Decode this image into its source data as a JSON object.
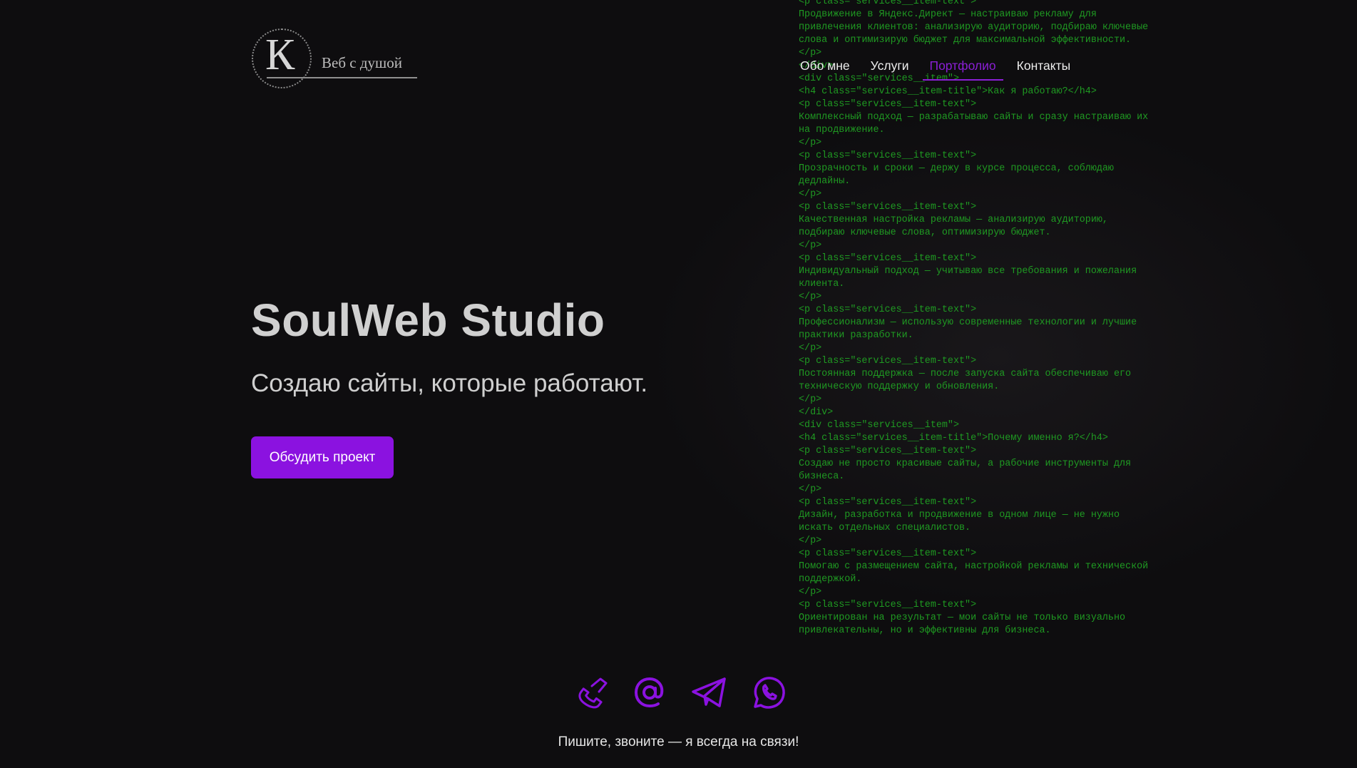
{
  "logo": {
    "letter": "К",
    "tagline": "Веб с душой"
  },
  "nav": {
    "items": [
      {
        "label": "Обо мне",
        "active": false
      },
      {
        "label": "Услуги",
        "active": false
      },
      {
        "label": "Портфолио",
        "active": true
      },
      {
        "label": "Контакты",
        "active": false
      }
    ]
  },
  "hero": {
    "title": "SoulWeb Studio",
    "subtitle": "Создаю сайты, которые работают.",
    "cta_label": "Обсудить проект"
  },
  "code_lines": [
    "<p class=\"services__item-text\">",
    "Продвижение в Яндекс.Директ — настраиваю рекламу для",
    "привлечения клиентов: анализирую аудиторию, подбираю ключевые",
    "слова и оптимизирую бюджет для максимальной эффективности.",
    "</p>",
    "</div>",
    "<div class=\"services__item\">",
    "<h4 class=\"services__item-title\">Как я работаю?</h4>",
    "<p class=\"services__item-text\">",
    "Комплексный подход — разрабатываю сайты и сразу настраиваю их",
    "на продвижение.",
    "</p>",
    "<p class=\"services__item-text\">",
    "Прозрачность и сроки — держу в курсе процесса, соблюдаю",
    "дедлайны.",
    "</p>",
    "<p class=\"services__item-text\">",
    "Качественная настройка рекламы — анализирую аудиторию,",
    "подбираю ключевые слова, оптимизирую бюджет.",
    "</p>",
    "<p class=\"services__item-text\">",
    "Индивидуальный подход — учитываю все требования и пожелания",
    "клиента.",
    "</p>",
    "<p class=\"services__item-text\">",
    "Профессионализм — использую современные технологии и лучшие",
    "практики разработки.",
    "</p>",
    "<p class=\"services__item-text\">",
    "Постоянная поддержка — после запуска сайта обеспечиваю его",
    "техническую поддержку и обновления.",
    "</p>",
    "</div>",
    "<div class=\"services__item\">",
    "<h4 class=\"services__item-title\">Почему именно я?</h4>",
    "<p class=\"services__item-text\">",
    "Создаю не просто красивые сайты, а рабочие инструменты для",
    "бизнеса.",
    "</p>",
    "<p class=\"services__item-text\">",
    "Дизайн, разработка и продвижение в одном лице — не нужно",
    "искать отдельных специалистов.",
    "</p>",
    "<p class=\"services__item-text\">",
    "Помогаю с размещением сайта, настройкой рекламы и технической",
    "поддержкой.",
    "</p>",
    "<p class=\"services__item-text\">",
    "Ориентирован на результат — мои сайты не только визуально",
    "привлекательны, но и эффективны для бизнеса."
  ],
  "contacts": {
    "icons": [
      "phone-icon",
      "email-at-icon",
      "telegram-icon",
      "whatsapp-icon"
    ],
    "tagline": "Пишите, звоните — я всегда на связи!"
  },
  "colors": {
    "accent": "#8b12e0",
    "code_green": "#1f9a22",
    "background": "#0e0d0f"
  }
}
